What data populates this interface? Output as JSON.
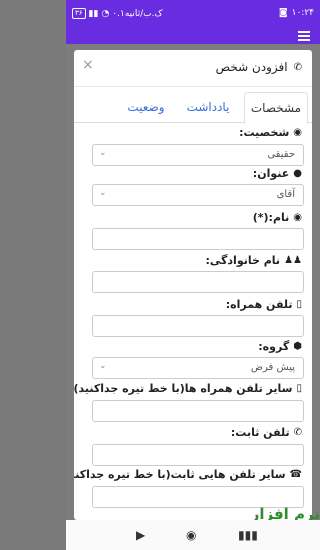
{
  "status_bar": {
    "time": "۱۰:۲۴",
    "carrier": "۰.۱ک.ب/ثانیه",
    "battery": "۳۶"
  },
  "modal": {
    "title": "افزودن شخص",
    "close": "×"
  },
  "tabs": [
    {
      "label": "مشخصات",
      "active": true
    },
    {
      "label": "یادداشت",
      "active": false
    },
    {
      "label": "وضعیت",
      "active": false
    }
  ],
  "form": {
    "entity_label": "شخصیت:",
    "entity_value": "حقیقی",
    "title_label": "عنوان:",
    "title_value": "آقای",
    "name_label": "نام:(*)",
    "family_label": "نام خانوادگی:",
    "mobile_label": "تلفن همراه:",
    "group_label": "گروه:",
    "group_value": "پیش فرض",
    "other_mobiles_label": "سایر تلفن همراه ها(با خط تیره جداکنید)",
    "phone_label": "تلفن ثابت:",
    "other_phones_label": "سایر تلفن هایی ثابت(با خط تیره جداکنید)"
  },
  "watermark": "نرم افزار یاب"
}
